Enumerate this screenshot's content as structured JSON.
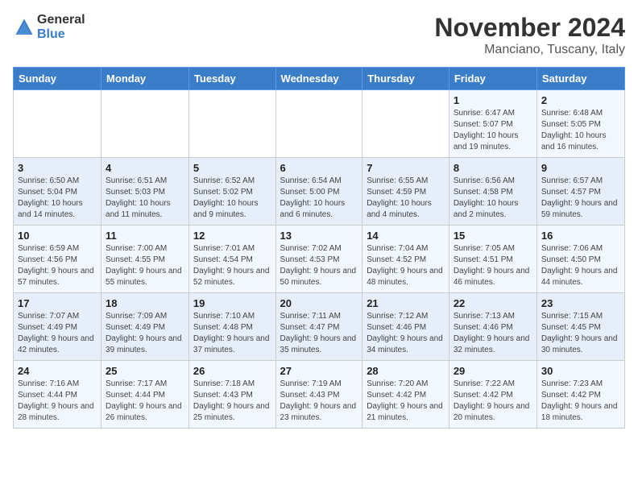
{
  "logo": {
    "general": "General",
    "blue": "Blue"
  },
  "title": "November 2024",
  "location": "Manciano, Tuscany, Italy",
  "days_of_week": [
    "Sunday",
    "Monday",
    "Tuesday",
    "Wednesday",
    "Thursday",
    "Friday",
    "Saturday"
  ],
  "weeks": [
    [
      {
        "day": "",
        "info": ""
      },
      {
        "day": "",
        "info": ""
      },
      {
        "day": "",
        "info": ""
      },
      {
        "day": "",
        "info": ""
      },
      {
        "day": "",
        "info": ""
      },
      {
        "day": "1",
        "info": "Sunrise: 6:47 AM\nSunset: 5:07 PM\nDaylight: 10 hours and 19 minutes."
      },
      {
        "day": "2",
        "info": "Sunrise: 6:48 AM\nSunset: 5:05 PM\nDaylight: 10 hours and 16 minutes."
      }
    ],
    [
      {
        "day": "3",
        "info": "Sunrise: 6:50 AM\nSunset: 5:04 PM\nDaylight: 10 hours and 14 minutes."
      },
      {
        "day": "4",
        "info": "Sunrise: 6:51 AM\nSunset: 5:03 PM\nDaylight: 10 hours and 11 minutes."
      },
      {
        "day": "5",
        "info": "Sunrise: 6:52 AM\nSunset: 5:02 PM\nDaylight: 10 hours and 9 minutes."
      },
      {
        "day": "6",
        "info": "Sunrise: 6:54 AM\nSunset: 5:00 PM\nDaylight: 10 hours and 6 minutes."
      },
      {
        "day": "7",
        "info": "Sunrise: 6:55 AM\nSunset: 4:59 PM\nDaylight: 10 hours and 4 minutes."
      },
      {
        "day": "8",
        "info": "Sunrise: 6:56 AM\nSunset: 4:58 PM\nDaylight: 10 hours and 2 minutes."
      },
      {
        "day": "9",
        "info": "Sunrise: 6:57 AM\nSunset: 4:57 PM\nDaylight: 9 hours and 59 minutes."
      }
    ],
    [
      {
        "day": "10",
        "info": "Sunrise: 6:59 AM\nSunset: 4:56 PM\nDaylight: 9 hours and 57 minutes."
      },
      {
        "day": "11",
        "info": "Sunrise: 7:00 AM\nSunset: 4:55 PM\nDaylight: 9 hours and 55 minutes."
      },
      {
        "day": "12",
        "info": "Sunrise: 7:01 AM\nSunset: 4:54 PM\nDaylight: 9 hours and 52 minutes."
      },
      {
        "day": "13",
        "info": "Sunrise: 7:02 AM\nSunset: 4:53 PM\nDaylight: 9 hours and 50 minutes."
      },
      {
        "day": "14",
        "info": "Sunrise: 7:04 AM\nSunset: 4:52 PM\nDaylight: 9 hours and 48 minutes."
      },
      {
        "day": "15",
        "info": "Sunrise: 7:05 AM\nSunset: 4:51 PM\nDaylight: 9 hours and 46 minutes."
      },
      {
        "day": "16",
        "info": "Sunrise: 7:06 AM\nSunset: 4:50 PM\nDaylight: 9 hours and 44 minutes."
      }
    ],
    [
      {
        "day": "17",
        "info": "Sunrise: 7:07 AM\nSunset: 4:49 PM\nDaylight: 9 hours and 42 minutes."
      },
      {
        "day": "18",
        "info": "Sunrise: 7:09 AM\nSunset: 4:49 PM\nDaylight: 9 hours and 39 minutes."
      },
      {
        "day": "19",
        "info": "Sunrise: 7:10 AM\nSunset: 4:48 PM\nDaylight: 9 hours and 37 minutes."
      },
      {
        "day": "20",
        "info": "Sunrise: 7:11 AM\nSunset: 4:47 PM\nDaylight: 9 hours and 35 minutes."
      },
      {
        "day": "21",
        "info": "Sunrise: 7:12 AM\nSunset: 4:46 PM\nDaylight: 9 hours and 34 minutes."
      },
      {
        "day": "22",
        "info": "Sunrise: 7:13 AM\nSunset: 4:46 PM\nDaylight: 9 hours and 32 minutes."
      },
      {
        "day": "23",
        "info": "Sunrise: 7:15 AM\nSunset: 4:45 PM\nDaylight: 9 hours and 30 minutes."
      }
    ],
    [
      {
        "day": "24",
        "info": "Sunrise: 7:16 AM\nSunset: 4:44 PM\nDaylight: 9 hours and 28 minutes."
      },
      {
        "day": "25",
        "info": "Sunrise: 7:17 AM\nSunset: 4:44 PM\nDaylight: 9 hours and 26 minutes."
      },
      {
        "day": "26",
        "info": "Sunrise: 7:18 AM\nSunset: 4:43 PM\nDaylight: 9 hours and 25 minutes."
      },
      {
        "day": "27",
        "info": "Sunrise: 7:19 AM\nSunset: 4:43 PM\nDaylight: 9 hours and 23 minutes."
      },
      {
        "day": "28",
        "info": "Sunrise: 7:20 AM\nSunset: 4:42 PM\nDaylight: 9 hours and 21 minutes."
      },
      {
        "day": "29",
        "info": "Sunrise: 7:22 AM\nSunset: 4:42 PM\nDaylight: 9 hours and 20 minutes."
      },
      {
        "day": "30",
        "info": "Sunrise: 7:23 AM\nSunset: 4:42 PM\nDaylight: 9 hours and 18 minutes."
      }
    ]
  ]
}
